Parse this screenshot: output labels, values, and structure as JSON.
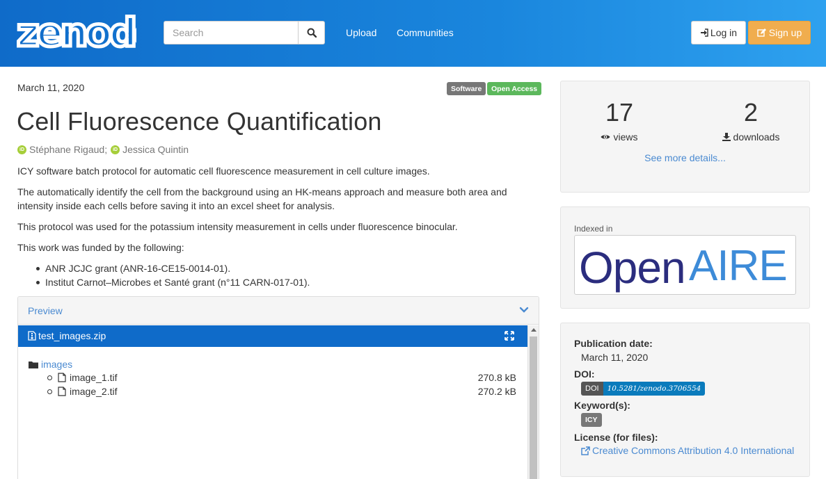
{
  "header": {
    "logo_text": "zenodo",
    "search_placeholder": "Search",
    "nav": [
      "Upload",
      "Communities"
    ],
    "login_label": "Log in",
    "signup_label": "Sign up"
  },
  "record": {
    "date": "March 11, 2020",
    "badges": [
      "Software",
      "Open Access"
    ],
    "title": "Cell Fluorescence Quantification",
    "authors": [
      "Stéphane Rigaud;",
      "Jessica Quintin"
    ],
    "description": [
      "ICY software batch protocol for automatic cell fluorescence measurement in cell culture images.",
      "The automatically identify the cell from the background using an HK-means approach and measure both area and intensity inside each cells before saving it into an excel sheet for analysis.",
      "This protocol was used for the potassium intensity measurement in cells under fluorescence binocular.",
      "This work was funded by the following:"
    ],
    "funding": [
      "ANR JCJC grant (ANR-16-CE15-0014-01).",
      "Institut Carnot–Microbes et Santé grant (n°11 CARN-017-01)."
    ]
  },
  "preview": {
    "label": "Preview",
    "file_name": "test_images.zip",
    "folder": "images",
    "files": [
      {
        "name": "image_1.tif",
        "size": "270.8 kB"
      },
      {
        "name": "image_2.tif",
        "size": "270.2 kB"
      }
    ]
  },
  "stats": {
    "views": "17",
    "views_label": "views",
    "downloads": "2",
    "downloads_label": "downloads",
    "see_more": "See more details..."
  },
  "indexed": {
    "label": "Indexed in",
    "logo_text_open": "Open",
    "logo_text_aire": "AIRE"
  },
  "metadata": {
    "pub_date_label": "Publication date:",
    "pub_date": "March 11, 2020",
    "doi_label": "DOI:",
    "doi_prefix": "DOI",
    "doi_value": "10.5281/zenodo.3706554",
    "keywords_label": "Keyword(s):",
    "keyword": "ICY",
    "license_label": "License (for files):",
    "license": "Creative Commons Attribution 4.0 International"
  },
  "colors": {
    "header_start": "#0f6bc9",
    "header_end": "#2ea1ef",
    "link": "#4a8ad1",
    "signup": "#f0ad4e",
    "open_access": "#5cb85c",
    "openaire_dark": "#2b2d7e",
    "openaire_light": "#3d8bd8"
  }
}
